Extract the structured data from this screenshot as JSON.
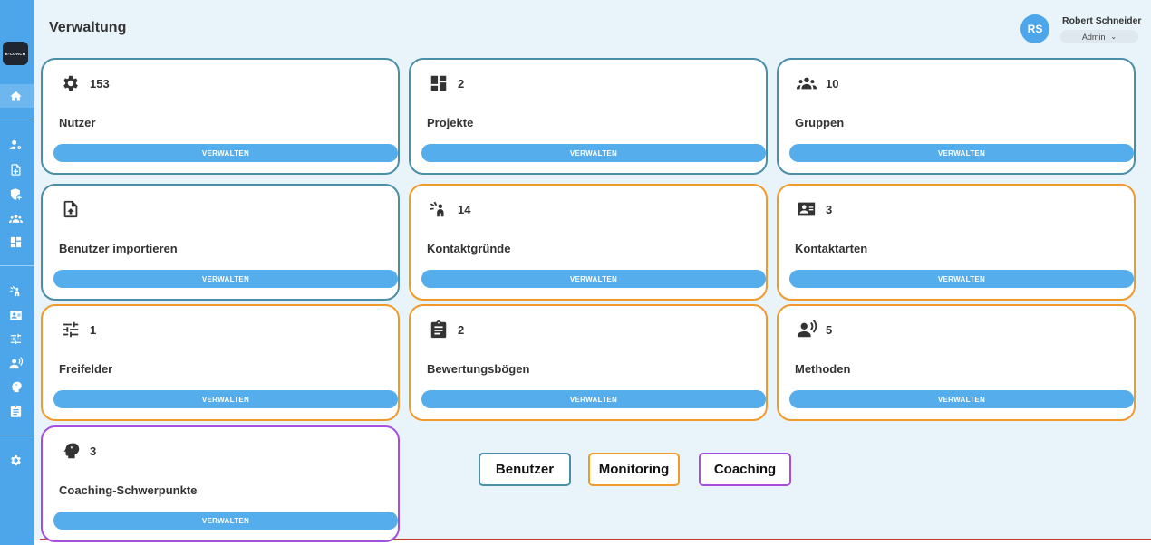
{
  "app": {
    "logo_text": "E-COACH"
  },
  "header": {
    "title": "Verwaltung",
    "user": {
      "initials": "RS",
      "name": "Robert Schneider",
      "role": "Admin"
    }
  },
  "cards": [
    {
      "count": "153",
      "label": "Nutzer",
      "button": "VERWALTEN",
      "icon": "gear-icon",
      "category": "benutzer"
    },
    {
      "count": "2",
      "label": "Projekte",
      "button": "VERWALTEN",
      "icon": "dashboard-icon",
      "category": "benutzer"
    },
    {
      "count": "10",
      "label": "Gruppen",
      "button": "VERWALTEN",
      "icon": "groups-icon",
      "category": "benutzer"
    },
    {
      "count": "",
      "label": "Benutzer importieren",
      "button": "VERWALTEN",
      "icon": "file-upload-icon",
      "category": "benutzer"
    },
    {
      "count": "14",
      "label": "Kontaktgründe",
      "button": "VERWALTEN",
      "icon": "contact-reason-icon",
      "category": "monitoring"
    },
    {
      "count": "3",
      "label": "Kontaktarten",
      "button": "VERWALTEN",
      "icon": "contact-card-icon",
      "category": "monitoring"
    },
    {
      "count": "1",
      "label": "Freifelder",
      "button": "VERWALTEN",
      "icon": "sliders-icon",
      "category": "monitoring"
    },
    {
      "count": "2",
      "label": "Bewertungsbögen",
      "button": "VERWALTEN",
      "icon": "clipboard-icon",
      "category": "monitoring"
    },
    {
      "count": "5",
      "label": "Methoden",
      "button": "VERWALTEN",
      "icon": "person-voice-icon",
      "category": "monitoring"
    },
    {
      "count": "3",
      "label": "Coaching-Schwerpunkte",
      "button": "VERWALTEN",
      "icon": "head-gear-icon",
      "category": "coaching"
    }
  ],
  "legend": [
    {
      "label": "Benutzer",
      "color": "#4a8fa8"
    },
    {
      "label": "Monitoring",
      "color": "#f19a2b"
    },
    {
      "label": "Coaching",
      "color": "#a64ee0"
    }
  ],
  "sidebar": {
    "icons": [
      "home-icon",
      "user-settings-icon",
      "file-add-icon",
      "shield-add-icon",
      "groups-icon",
      "dashboard-icon",
      "contact-reason-icon",
      "contact-card-icon",
      "sliders-icon",
      "person-voice-icon",
      "head-gear-icon",
      "clipboard-icon",
      "settings-icon"
    ]
  },
  "colors": {
    "sidebar": "#4da6ea",
    "accent": "#55adec",
    "background": "#e9f3fa"
  }
}
